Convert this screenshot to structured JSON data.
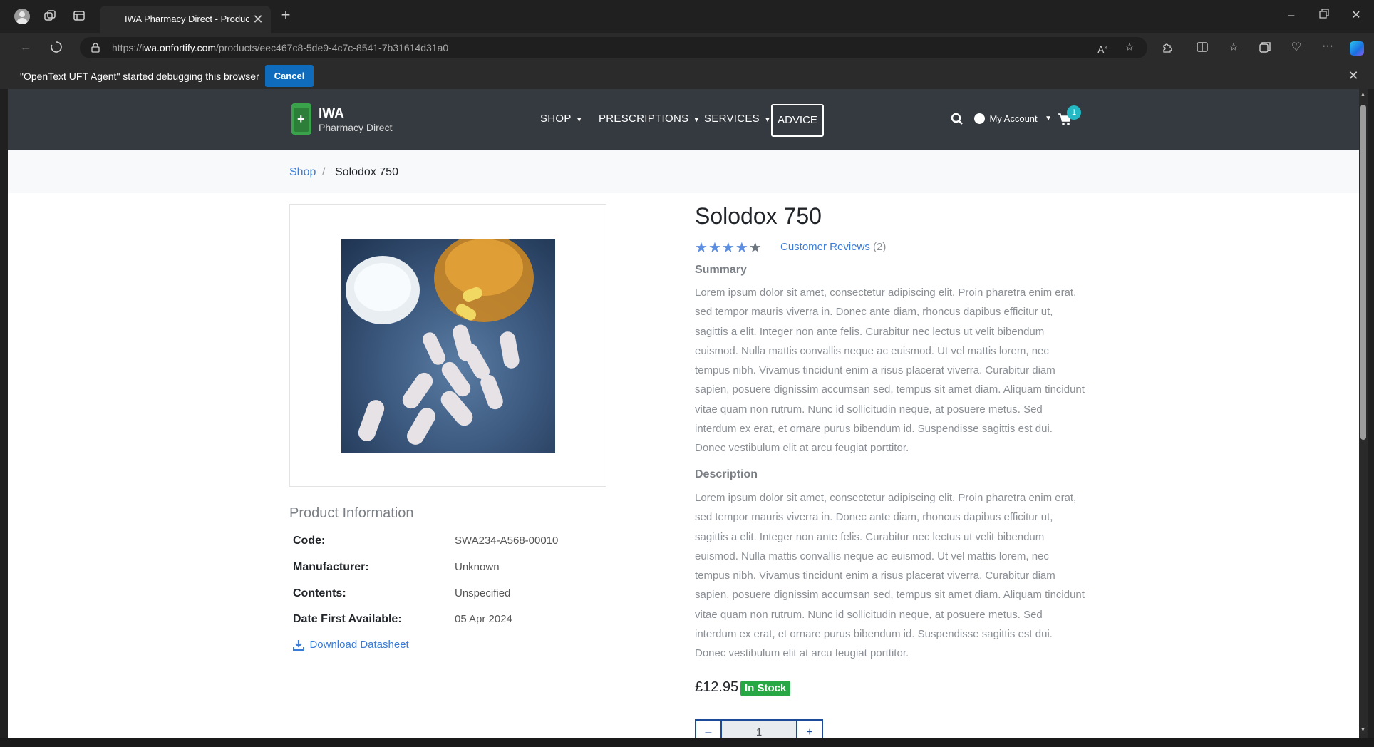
{
  "browser": {
    "tab_title": "IWA Pharmacy Direct - Product :",
    "url_prefix": "https://",
    "url_domain": "iwa.onfortify.com",
    "url_path": "/products/eec467c8-5de9-4c7c-8541-7b31614d31a0",
    "infobar_text": "\"OpenText UFT Agent\" started debugging this browser",
    "infobar_button": "Cancel"
  },
  "site": {
    "logo_title": "IWA",
    "logo_subtitle": "Pharmacy Direct",
    "nav": {
      "shop": "SHOP",
      "prescriptions": "PRESCRIPTIONS",
      "services": "SERVICES",
      "advice": "ADVICE"
    },
    "account_label": "My Account",
    "cart_count": "1",
    "accent": "#25b8c4"
  },
  "breadcrumb": {
    "shop": "Shop",
    "separator": "/",
    "current": "Solodox 750"
  },
  "product": {
    "name": "Solodox 750",
    "rating": 4,
    "rating_max": 5,
    "reviews_label": "Customer Reviews",
    "reviews_count": "(2)",
    "summary_heading": "Summary",
    "summary_text": "Lorem ipsum dolor sit amet, consectetur adipiscing elit. Proin pharetra enim erat, sed tempor mauris viverra in. Donec ante diam, rhoncus dapibus efficitur ut, sagittis a elit. Integer non ante felis. Curabitur nec lectus ut velit bibendum euismod. Nulla mattis convallis neque ac euismod. Ut vel mattis lorem, nec tempus nibh. Vivamus tincidunt enim a risus placerat viverra. Curabitur diam sapien, posuere dignissim accumsan sed, tempus sit amet diam. Aliquam tincidunt vitae quam non rutrum. Nunc id sollicitudin neque, at posuere metus. Sed interdum ex erat, et ornare purus bibendum id. Suspendisse sagittis est dui. Donec vestibulum elit at arcu feugiat porttitor.",
    "description_heading": "Description",
    "description_text": "Lorem ipsum dolor sit amet, consectetur adipiscing elit. Proin pharetra enim erat, sed tempor mauris viverra in. Donec ante diam, rhoncus dapibus efficitur ut, sagittis a elit. Integer non ante felis. Curabitur nec lectus ut velit bibendum euismod. Nulla mattis convallis neque ac euismod. Ut vel mattis lorem, nec tempus nibh. Vivamus tincidunt enim a risus placerat viverra. Curabitur diam sapien, posuere dignissim accumsan sed, tempus sit amet diam. Aliquam tincidunt vitae quam non rutrum. Nunc id sollicitudin neque, at posuere metus. Sed interdum ex erat, et ornare purus bibendum id. Suspendisse sagittis est dui. Donec vestibulum elit at arcu feugiat porttitor.",
    "price": "£12.95",
    "stock_badge": "In Stock",
    "stock_color": "#28a745",
    "quantity": "1",
    "qty_minus": "–",
    "qty_plus": "+"
  },
  "info": {
    "heading": "Product Information",
    "code_label": "Code:",
    "code_value": "SWA234-A568-00010",
    "manufacturer_label": "Manufacturer:",
    "manufacturer_value": "Unknown",
    "contents_label": "Contents:",
    "contents_value": "Unspecified",
    "date_label": "Date First Available:",
    "date_value": "05 Apr 2024",
    "download_label": "Download Datasheet"
  }
}
